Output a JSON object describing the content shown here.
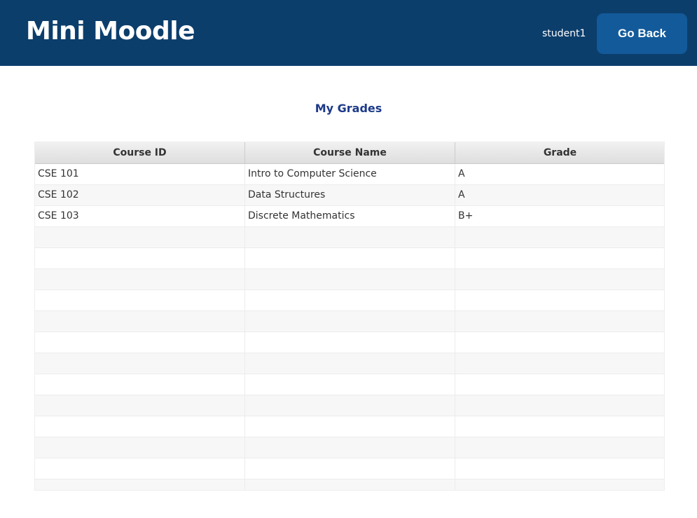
{
  "header": {
    "title": "Mini Moodle",
    "user": "student1",
    "go_back": "Go Back"
  },
  "page": {
    "title": "My Grades"
  },
  "table": {
    "columns": [
      "Course ID",
      "Course Name",
      "Grade"
    ],
    "rows": [
      [
        "CSE 101",
        "Intro to Computer Science",
        "A"
      ],
      [
        "CSE 102",
        "Data Structures",
        "A"
      ],
      [
        "CSE 103",
        "Discrete Mathematics",
        "B+"
      ]
    ]
  },
  "colors": {
    "header": "#0c3e6c",
    "button": "#135a9a",
    "title": "#1d3a8a"
  }
}
